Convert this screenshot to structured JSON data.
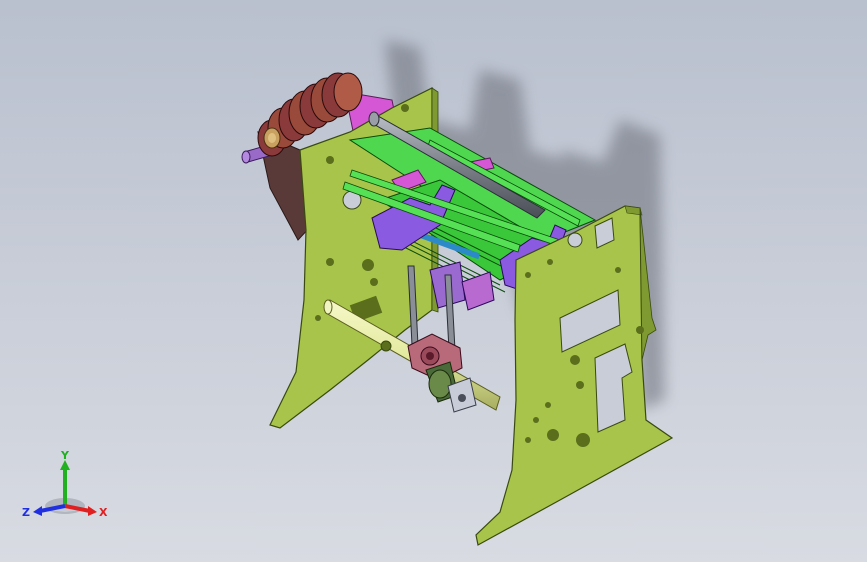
{
  "viewport": {
    "background_top": "#b9c0ce",
    "background_bottom": "#d8dbe2"
  },
  "model": {
    "frame_color": "#a8c44a",
    "frame_edge": "#3a4a10",
    "mechanism_green": "#4fd84f",
    "mechanism_purple": "#8a5ae0",
    "mechanism_magenta": "#d84fd8",
    "gear_color": "#8a3a3a",
    "bar_color": "#e8eea0",
    "rod_color": "#7a7e86"
  },
  "triad": {
    "x_label": "X",
    "y_label": "Y",
    "z_label": "Z",
    "x_color": "#e02020",
    "y_color": "#20b020",
    "z_color": "#2030e0"
  }
}
